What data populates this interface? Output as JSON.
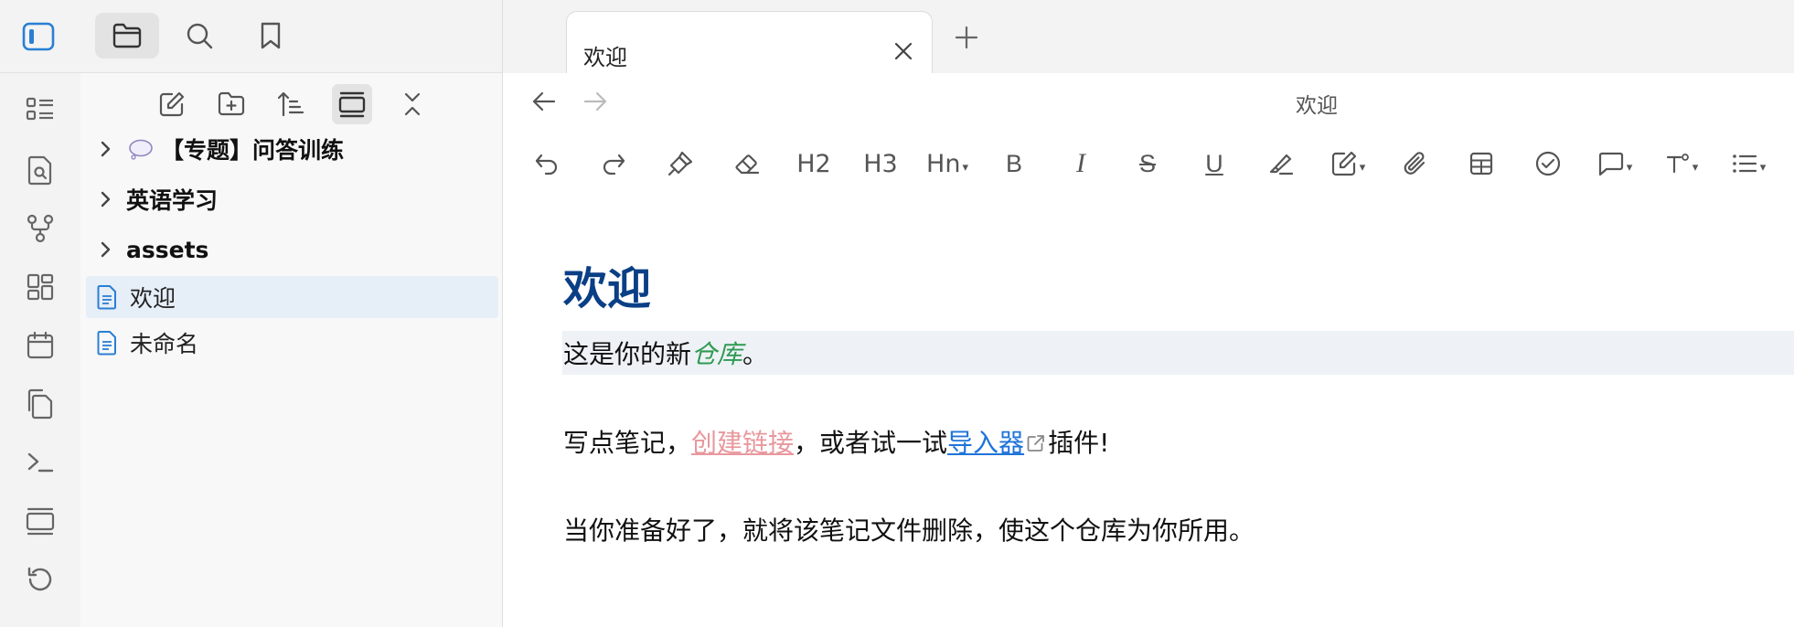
{
  "tabs": [
    {
      "label": "欢迎"
    }
  ],
  "view": {
    "title": "欢迎"
  },
  "explorer": {
    "items": [
      {
        "type": "folder",
        "label": "【专题】问答训练",
        "emoji": "speech-bubble"
      },
      {
        "type": "folder",
        "label": "英语学习"
      },
      {
        "type": "folder",
        "label": "assets"
      },
      {
        "type": "file",
        "label": "欢迎",
        "selected": true
      },
      {
        "type": "file",
        "label": "未命名"
      }
    ]
  },
  "toolbar": {
    "h2": "H2",
    "h3": "H3",
    "hn": "Hn",
    "bold": "B",
    "italic": "I",
    "strike": "S",
    "underline": "U",
    "caret": "▾"
  },
  "document": {
    "heading": "欢迎",
    "p1_before": "这是你的新",
    "p1_em": "仓库",
    "p1_after": "。",
    "p2_before": "写点笔记，",
    "p2_link1": "创建链接",
    "p2_mid": "，或者试一试",
    "p2_link2": "导入器",
    "p2_after": "插件!",
    "p3": "当你准备好了，就将该笔记文件删除，使这个仓库为你所用。"
  },
  "colors": {
    "accent": "#2a7fd4",
    "heading": "#0a3f86",
    "italic_green": "#2f9a53",
    "unresolved_link": "#e8979d",
    "external_link": "#1f74d8"
  }
}
